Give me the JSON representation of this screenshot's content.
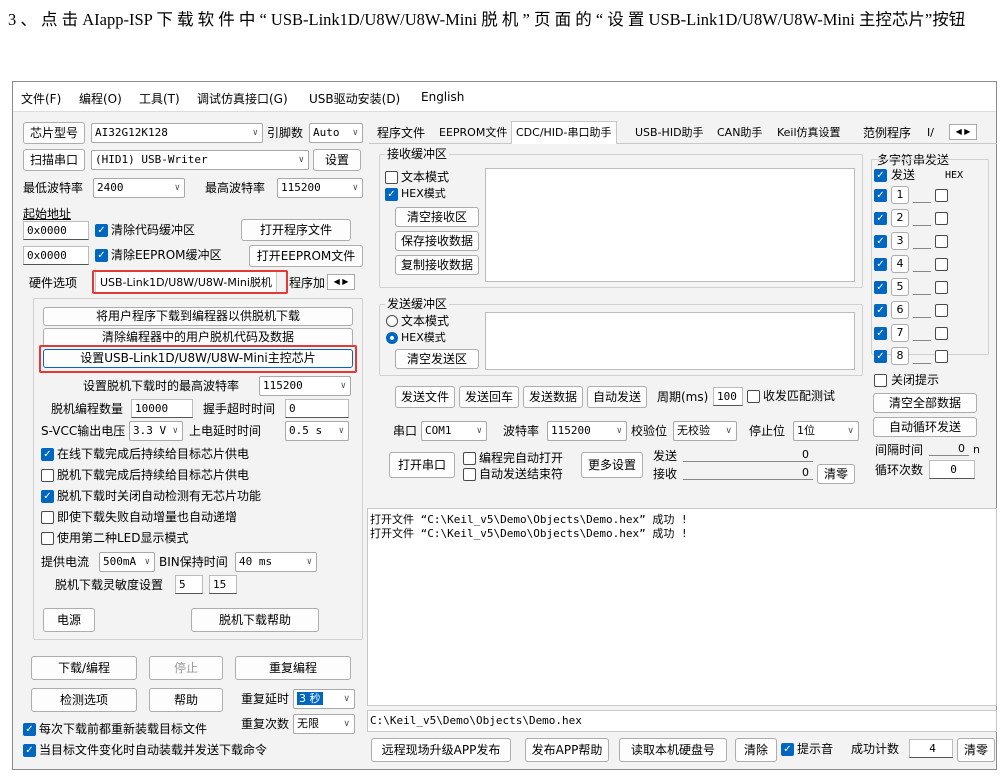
{
  "instruction": "3 、 点 击 AIapp-ISP 下 载 软 件 中 “ USB-Link1D/U8W/U8W-Mini 脱 机 ” 页 面 的 “ 设 置 USB-Link1D/U8W/U8W-Mini 主控芯片”按钮",
  "menu": [
    "文件(F)",
    "编程(O)",
    "工具(T)",
    "调试仿真接口(G)",
    "USB驱动安装(D)",
    "English"
  ],
  "left": {
    "chip_label": "芯片型号",
    "chip_value": "AI32G12K128",
    "pins_label": "引脚数",
    "pins_value": "Auto",
    "scan_label": "扫描串口",
    "port_value": "(HID1) USB-Writer",
    "settings_btn": "设置",
    "min_baud_label": "最低波特率",
    "min_baud": "2400",
    "max_baud_label": "最高波特率",
    "max_baud": "115200",
    "start_addr_label": "起始地址",
    "addr1": "0x0000",
    "clear_code": "清除代码缓冲区",
    "open_prog": "打开程序文件",
    "addr2": "0x0000",
    "clear_eeprom": "清除EEPROM缓冲区",
    "open_eeprom": "打开EEPROM文件",
    "tabs": [
      "硬件选项",
      "USB-Link1D/U8W/U8W-Mini脱机",
      "程序加"
    ],
    "offline": {
      "btn1": "将用户程序下载到编程器以供脱机下载",
      "btn2": "清除编程器中的用户脱机代码及数据",
      "btn3": "设置USB-Link1D/U8W/U8W-Mini主控芯片",
      "max_baud_label": "设置脱机下载时的最高波特率",
      "max_baud": "115200",
      "count_label": "脱机编程数量",
      "count": "10000",
      "handshake_label": "握手超时时间",
      "handshake": "0",
      "svcc_label": "S-VCC输出电压",
      "svcc": "3.3 V",
      "delay_label": "上电延时时间",
      "delay": "0.5 s",
      "opt1": "在线下载完成后持续给目标芯片供电",
      "opt2": "脱机下载完成后持续给目标芯片供电",
      "opt3": "脱机下载时关闭自动检测有无芯片功能",
      "opt4": "即使下载失败自动增量也自动递增",
      "opt5": "使用第二种LED显示模式",
      "current_label": "提供电流",
      "current": "500mA",
      "bin_label": "BIN保持时间",
      "bin": "40 ms",
      "sens_label": "脱机下载灵敏度设置",
      "sens1": "5",
      "sens2": "15",
      "power_btn": "电源",
      "help_btn": "脱机下载帮助"
    },
    "download_btn": "下载/编程",
    "stop_btn": "停止",
    "reprog_btn": "重复编程",
    "detect_btn": "检测选项",
    "help_btn": "帮助",
    "repeat_delay_label": "重复延时",
    "repeat_delay": "3 秒",
    "repeat_count_label": "重复次数",
    "repeat_count": "无限",
    "reload_chk": "每次下载前都重新装载目标文件",
    "auto_chk": "当目标文件变化时自动装载并发送下载命令"
  },
  "right": {
    "tabs": [
      "程序文件",
      "EEPROM文件",
      "CDC/HID-串口助手",
      "USB-HID助手",
      "CAN助手",
      "Keil仿真设置",
      "范例程序",
      "I/"
    ],
    "recv_group": "接收缓冲区",
    "text_mode": "文本模式",
    "hex_mode": "HEX模式",
    "clear_recv": "清空接收区",
    "save_recv": "保存接收数据",
    "copy_recv": "复制接收数据",
    "send_group": "发送缓冲区",
    "clear_send": "清空发送区",
    "send_file": "发送文件",
    "send_back": "发送回车",
    "send_data": "发送数据",
    "auto_send": "自动发送",
    "period_label": "周期(ms)",
    "period": "100",
    "match_test": "收发匹配测试",
    "port_label": "串口",
    "port": "COM1",
    "baud_label": "波特率",
    "baud": "115200",
    "parity_label": "校验位",
    "parity": "无校验",
    "stop_label": "停止位",
    "stop": "1位",
    "open_port": "打开串口",
    "auto_open": "编程完自动打开",
    "auto_end": "自动发送结束符",
    "more": "更多设置",
    "send_label": "发送",
    "send_count": "0",
    "recv_label": "接收",
    "recv_count": "0",
    "clear_count": "清零",
    "multi_title": "多字符串发送",
    "multi_send": "发送",
    "hex_col": "HEX",
    "rows": [
      "1",
      "2",
      "3",
      "4",
      "5",
      "6",
      "7",
      "8"
    ],
    "close_tip": "关闭提示",
    "clear_all": "清空全部数据",
    "auto_loop": "自动循环发送",
    "interval_label": "间隔时间",
    "interval": "0",
    "interval_unit": "n",
    "loop_label": "循环次数",
    "loop": "0",
    "log": [
      "打开文件 “C:\\Keil_v5\\Demo\\Objects\\Demo.hex” 成功 !",
      "打开文件 “C:\\Keil_v5\\Demo\\Objects\\Demo.hex” 成功 !"
    ],
    "path": "C:\\Keil_v5\\Demo\\Objects\\Demo.hex",
    "remote_btn": "远程现场升级APP发布",
    "publish_help": "发布APP帮助",
    "read_disk": "读取本机硬盘号",
    "clear_btn": "清除",
    "beep": "提示音",
    "success_label": "成功计数",
    "success": "4",
    "clear_success": "清零"
  }
}
